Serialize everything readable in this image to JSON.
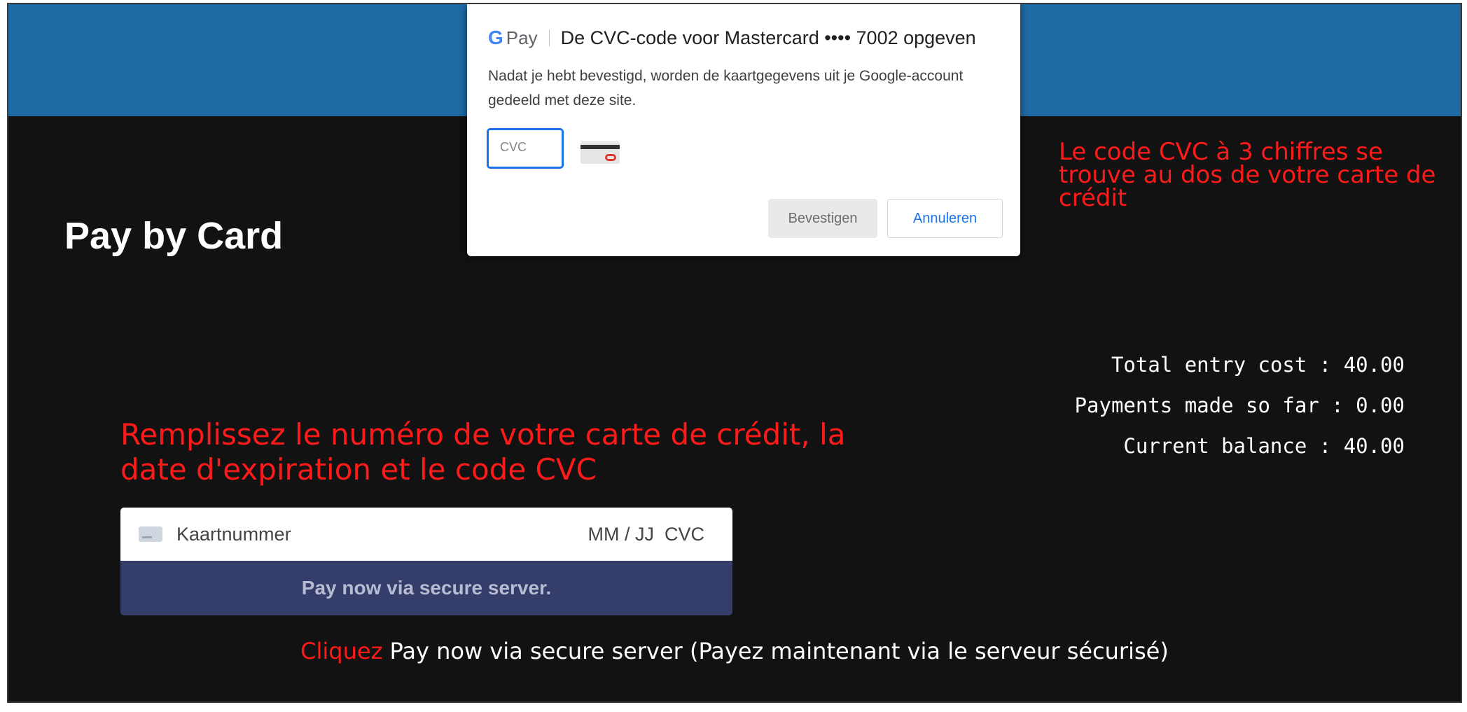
{
  "page": {
    "title": "Pay by Card"
  },
  "dialog": {
    "brand": "Pay",
    "brand_g": "G",
    "header": "De CVC-code voor Mastercard •••• 7002 opgeven",
    "description": "Nadat je hebt bevestigd, worden de kaartgegevens uit je Google-account gedeeld met deze site.",
    "cvc_placeholder": "CVC",
    "confirm_label": "Bevestigen",
    "cancel_label": "Annuleren"
  },
  "notes": {
    "cvc_hint": "Le code CVC à 3 chiffres se trouve au dos de votre carte de crédit",
    "fill_hint": "Remplissez le numéro de votre carte de crédit, la date d'expiration et le code CVC",
    "click_word": "Cliquez",
    "click_rest": "Pay now via secure server (Payez maintenant via le serveur sécurisé)"
  },
  "summary": {
    "total": "Total entry cost : 40.00",
    "paid": "Payments made so far : 0.00",
    "balance": "Current balance : 40.00"
  },
  "card_form": {
    "number_placeholder": "Kaartnummer",
    "meta_placeholder": "MM / JJ  CVC",
    "pay_button": "Pay now via secure server."
  },
  "colors": {
    "banner": "#1f6aa3",
    "background": "#121212",
    "note_red": "#ff1a1a",
    "pay_button": "#353d6b",
    "accent_blue": "#1a73e8"
  }
}
